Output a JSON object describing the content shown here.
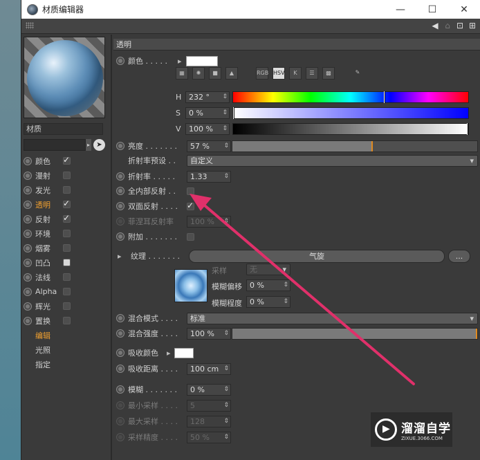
{
  "window": {
    "title": "材质编辑器",
    "minimize": "—",
    "maximize": "☐",
    "close": "✕"
  },
  "toolbar": {
    "arrow_icon": "◀",
    "lock_icon": "🔒",
    "plus_icon": "⊞"
  },
  "material": {
    "name": "材质"
  },
  "channels": [
    {
      "label": "颜色",
      "checked": true,
      "active": false,
      "radio": true
    },
    {
      "label": "漫射",
      "checked": false,
      "active": false,
      "radio": true
    },
    {
      "label": "发光",
      "checked": false,
      "active": false,
      "radio": true
    },
    {
      "label": "透明",
      "checked": true,
      "active": true,
      "radio": true
    },
    {
      "label": "反射",
      "checked": true,
      "active": false,
      "radio": true
    },
    {
      "label": "环境",
      "checked": false,
      "active": false,
      "radio": true
    },
    {
      "label": "烟雾",
      "checked": false,
      "active": false,
      "radio": true
    },
    {
      "label": "凹凸",
      "checked": false,
      "active": false,
      "radio": true,
      "white": true
    },
    {
      "label": "法线",
      "checked": false,
      "active": false,
      "radio": true
    },
    {
      "label": "Alpha",
      "checked": false,
      "active": false,
      "radio": true
    },
    {
      "label": "辉光",
      "checked": false,
      "active": false,
      "radio": true
    },
    {
      "label": "置换",
      "checked": false,
      "active": false,
      "radio": true
    },
    {
      "label": "编辑",
      "checked": null,
      "active": true,
      "radio": false
    },
    {
      "label": "光照",
      "checked": null,
      "active": false,
      "radio": false
    },
    {
      "label": "指定",
      "checked": null,
      "active": false,
      "radio": false
    }
  ],
  "section": {
    "title": "透明"
  },
  "color": {
    "label": "颜色 . . . . .",
    "tools": [
      "▦",
      "✺",
      "■",
      "▲",
      "RGB",
      "HSV",
      "K",
      "☰",
      "▩",
      "✎"
    ],
    "h_label": "H",
    "h_value": "232 °",
    "h_fraction": 0.644,
    "s_label": "S",
    "s_value": "0 %",
    "s_fraction": 0.0,
    "v_label": "V",
    "v_value": "100 %",
    "v_fraction": 1.0
  },
  "brightness": {
    "label": "亮度 . . . . . . .",
    "value": "57 %",
    "fraction": 0.57
  },
  "ior_preset": {
    "label": "折射率预设 . .",
    "value": "自定义"
  },
  "ior": {
    "label": "折射率 . . . . .",
    "value": "1.33"
  },
  "total_internal": {
    "label": "全内部反射 . .",
    "checked": false
  },
  "double_sided": {
    "label": "双面反射 . . . .",
    "checked": true
  },
  "fresnel": {
    "label": "菲涅耳反射率",
    "value": "100 %"
  },
  "additive": {
    "label": "附加 . . . . . . .",
    "checked": false
  },
  "texture": {
    "label": "纹理 . . . . . . .",
    "shader": "气旋",
    "more": "...",
    "sampling_label": "采样",
    "sampling_value": "无",
    "blur_offset_label": "模糊偏移",
    "blur_offset_value": "0 %",
    "blur_scale_label": "模糊程度",
    "blur_scale_value": "0 %"
  },
  "mix_mode": {
    "label": "混合模式 . . . .",
    "value": "标准"
  },
  "mix_strength": {
    "label": "混合强度 . . . .",
    "value": "100 %",
    "fraction": 1.0
  },
  "absorption_color": {
    "label": "吸收颜色"
  },
  "absorption_distance": {
    "label": "吸收距离 . . . .",
    "value": "100 cm"
  },
  "blur": {
    "label": "模糊 . . . . . . .",
    "value": "0 %"
  },
  "min_samples": {
    "label": "最小采样 . . . .",
    "value": "5"
  },
  "max_samples": {
    "label": "最大采样 . . . .",
    "value": "128"
  },
  "sample_accuracy": {
    "label": "采样精度 . . . .",
    "value": "50 %"
  },
  "watermark": {
    "title": "溜溜自学",
    "url": "ZIXUE.3066.COM"
  },
  "colors": {
    "accent": "#f0a030",
    "arrow": "#e0306a"
  }
}
